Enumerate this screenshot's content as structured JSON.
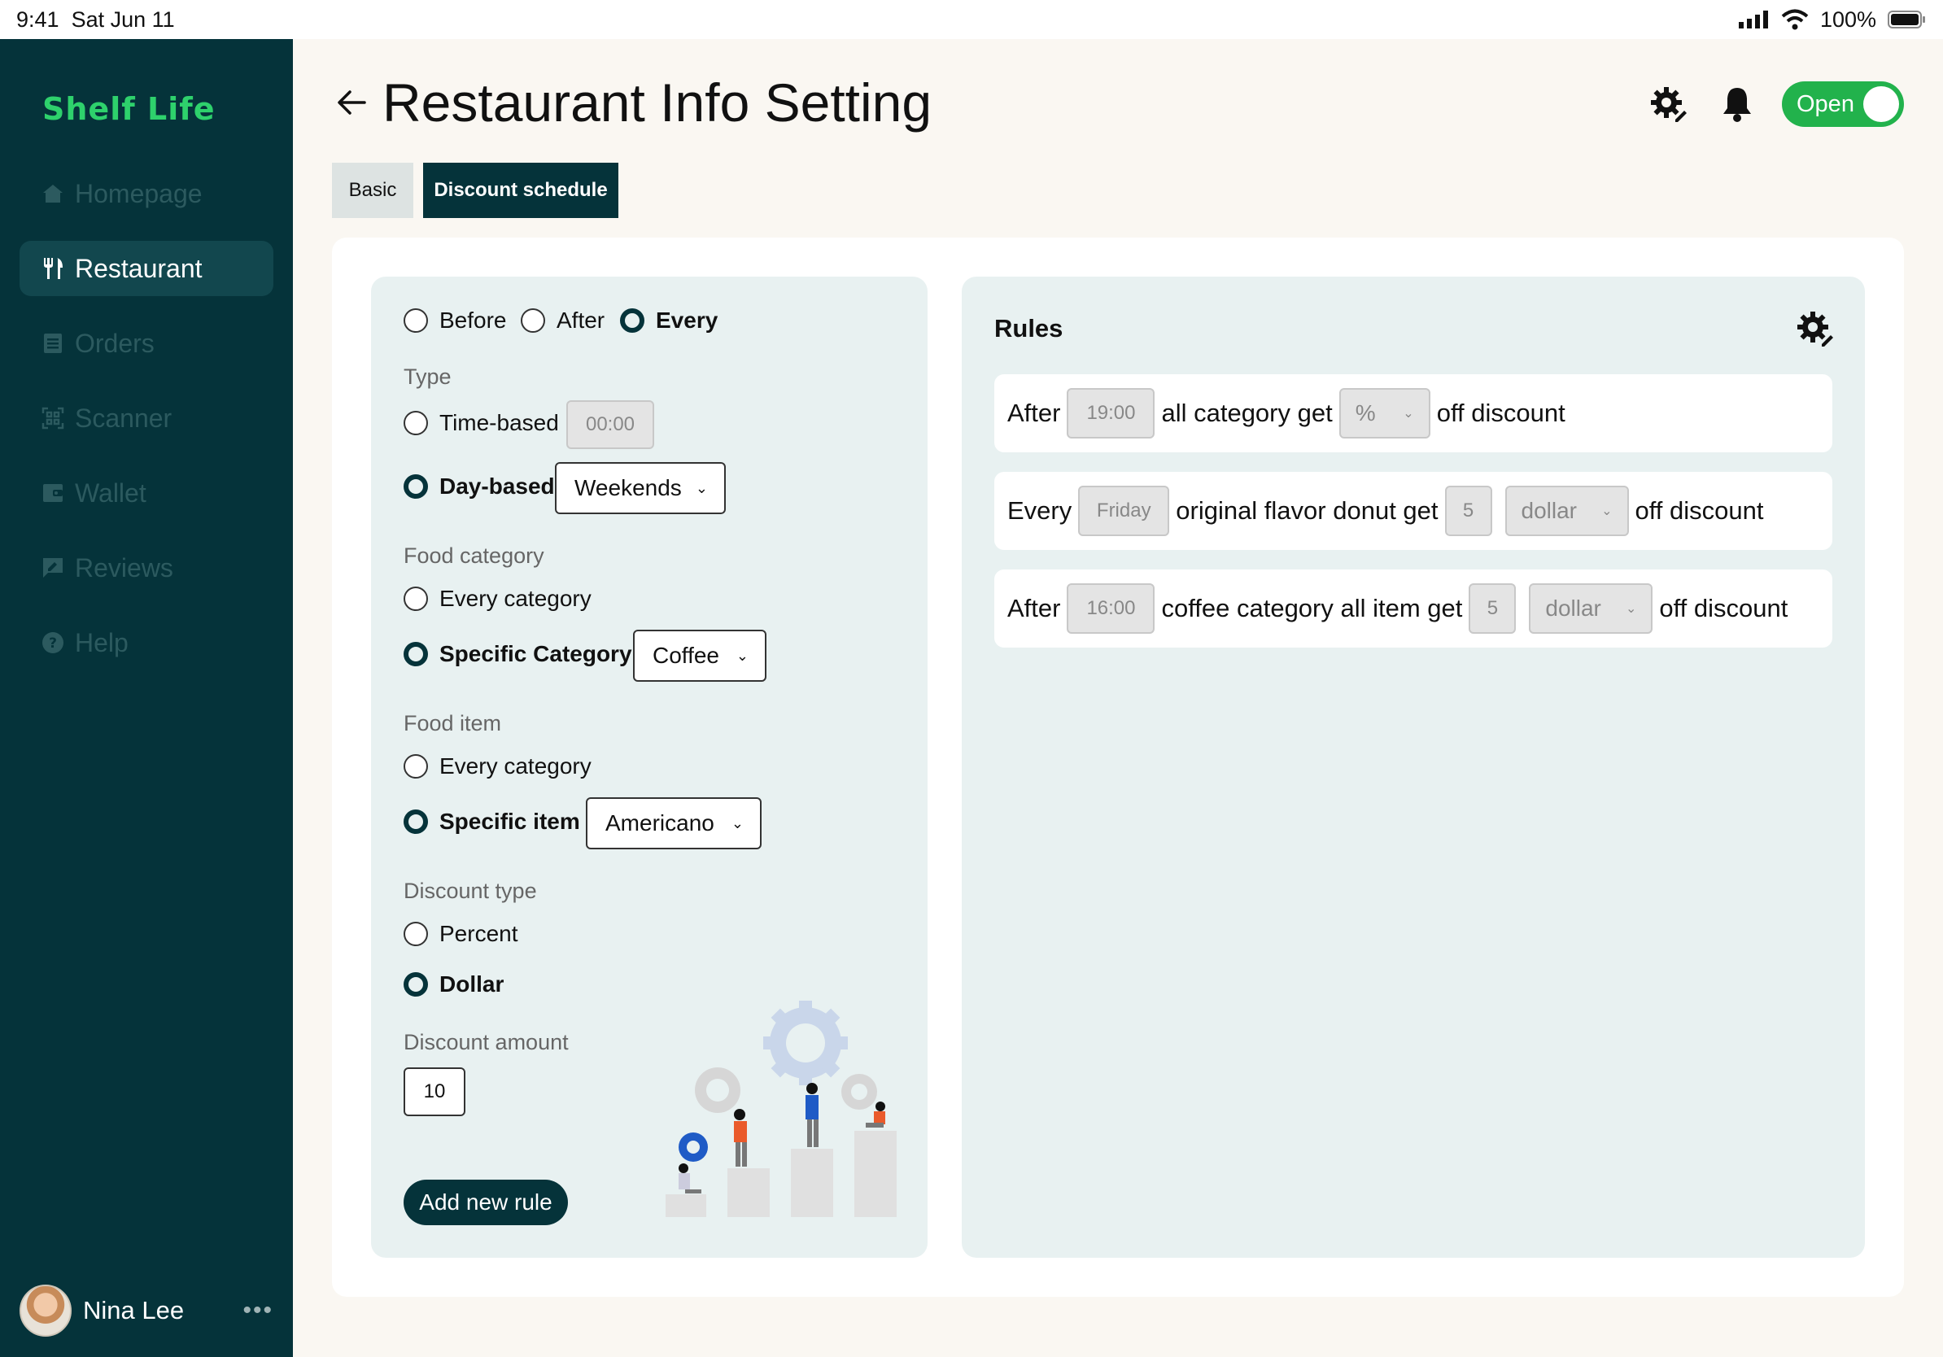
{
  "status_bar": {
    "time": "9:41",
    "date": "Sat Jun 11",
    "battery": "100%"
  },
  "sidebar": {
    "logo": "Shelf Life",
    "items": [
      {
        "label": "Homepage",
        "icon": "home-icon",
        "active": false
      },
      {
        "label": "Restaurant",
        "icon": "utensils-icon",
        "active": true
      },
      {
        "label": "Orders",
        "icon": "receipt-icon",
        "active": false
      },
      {
        "label": "Scanner",
        "icon": "qr-scan-icon",
        "active": false
      },
      {
        "label": "Wallet",
        "icon": "wallet-icon",
        "active": false
      },
      {
        "label": "Reviews",
        "icon": "review-icon",
        "active": false
      },
      {
        "label": "Help",
        "icon": "help-icon",
        "active": false
      }
    ],
    "user": {
      "name": "Nina Lee",
      "more": "•••"
    }
  },
  "header": {
    "title": "Restaurant Info Setting",
    "toggle_label": "Open"
  },
  "tabs": [
    {
      "label": "Basic",
      "active": false
    },
    {
      "label": "Discount schedule",
      "active": true
    }
  ],
  "form": {
    "timing": [
      {
        "label": "Before",
        "checked": false
      },
      {
        "label": "After",
        "checked": false
      },
      {
        "label": "Every",
        "checked": true
      }
    ],
    "type": {
      "label": "Type",
      "time_based": {
        "label": "Time-based",
        "checked": false,
        "value": "00:00"
      },
      "day_based": {
        "label": "Day-based",
        "checked": true,
        "value": "Weekends"
      }
    },
    "food_category": {
      "label": "Food category",
      "every": {
        "label": "Every category",
        "checked": false
      },
      "specific": {
        "label": "Specific Category",
        "checked": true,
        "value": "Coffee"
      }
    },
    "food_item": {
      "label": "Food item",
      "every": {
        "label": "Every category",
        "checked": false
      },
      "specific": {
        "label": "Specific item",
        "checked": true,
        "value": "Americano"
      }
    },
    "discount_type": {
      "label": "Discount type",
      "percent": {
        "label": "Percent",
        "checked": false
      },
      "dollar": {
        "label": "Dollar",
        "checked": true
      }
    },
    "discount_amount": {
      "label": "Discount amount",
      "value": "10"
    },
    "add_button": "Add new rule"
  },
  "rules": {
    "title": "Rules",
    "items": [
      {
        "prefix": "After",
        "when": "19:00",
        "target": "all category get",
        "amount": "",
        "unit": "%",
        "suffix": "off discount"
      },
      {
        "prefix": "Every",
        "when": "Friday",
        "target": "original flavor donut get",
        "amount": "5",
        "unit": "dollar",
        "suffix": "off discount"
      },
      {
        "prefix": "After",
        "when": "16:00",
        "target": "coffee category all item get",
        "amount": "5",
        "unit": "dollar",
        "suffix": "off discount"
      }
    ]
  },
  "colors": {
    "sidebar_bg": "#05333a",
    "accent_green": "#22b24c",
    "logo_green": "#2ed16c",
    "panel_bg": "#e8f1f1",
    "page_bg": "#faf7f2"
  }
}
